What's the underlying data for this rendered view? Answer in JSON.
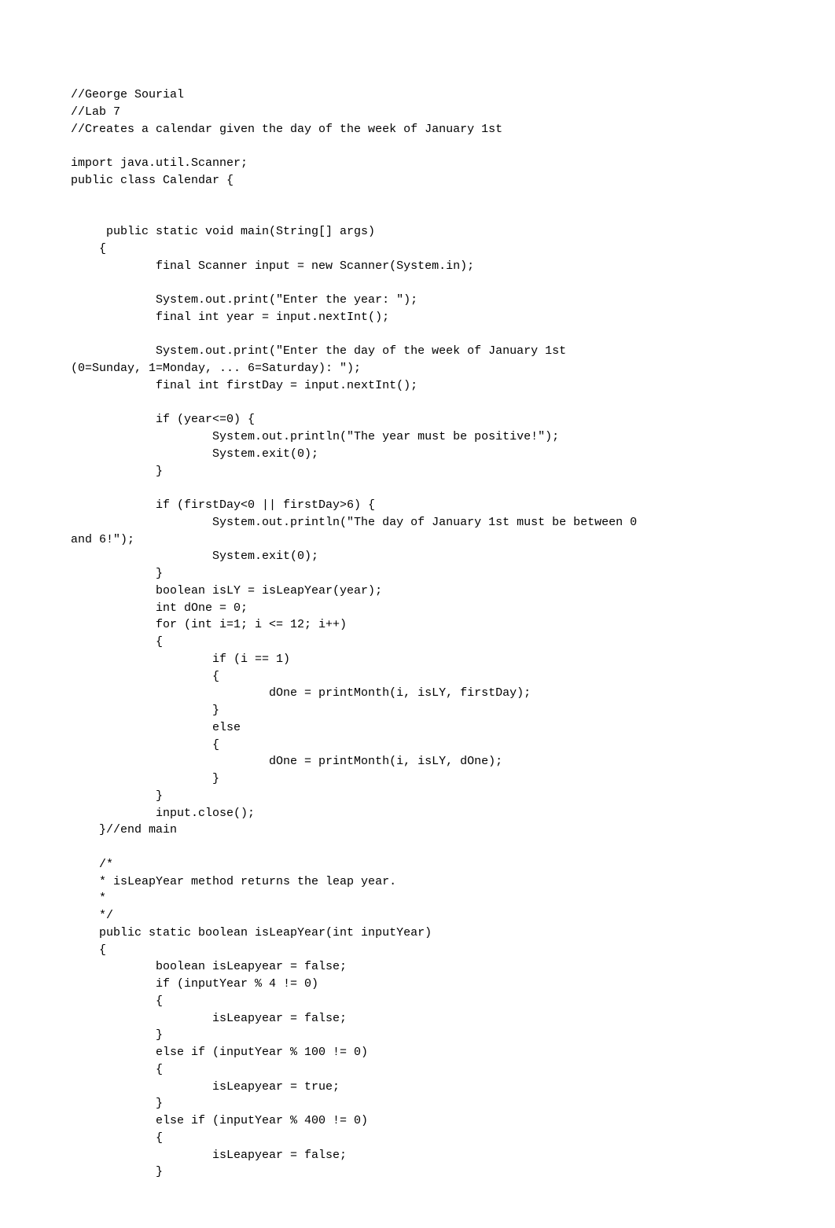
{
  "code": {
    "lines": [
      "//George Sourial",
      "//Lab 7",
      "//Creates a calendar given the day of the week of January 1st",
      "",
      "import java.util.Scanner;",
      "public class Calendar {",
      "",
      "",
      "     public static void main(String[] args)",
      "    {",
      "            final Scanner input = new Scanner(System.in);",
      "",
      "            System.out.print(\"Enter the year: \");",
      "            final int year = input.nextInt();",
      "",
      "            System.out.print(\"Enter the day of the week of January 1st ",
      "(0=Sunday, 1=Monday, ... 6=Saturday): \");",
      "            final int firstDay = input.nextInt();",
      "",
      "            if (year<=0) {",
      "                    System.out.println(\"The year must be positive!\");",
      "                    System.exit(0);",
      "            }",
      "",
      "            if (firstDay<0 || firstDay>6) {",
      "                    System.out.println(\"The day of January 1st must be between 0 ",
      "and 6!\");",
      "                    System.exit(0);",
      "            }",
      "            boolean isLY = isLeapYear(year);",
      "            int dOne = 0;",
      "            for (int i=1; i <= 12; i++)",
      "            {",
      "                    if (i == 1)",
      "                    {",
      "                            dOne = printMonth(i, isLY, firstDay);",
      "                    }",
      "                    else",
      "                    {",
      "                            dOne = printMonth(i, isLY, dOne);",
      "                    }",
      "            }",
      "            input.close();",
      "    }//end main",
      "",
      "    /*",
      "    * isLeapYear method returns the leap year.",
      "    *",
      "    */",
      "    public static boolean isLeapYear(int inputYear)",
      "    {",
      "            boolean isLeapyear = false;",
      "            if (inputYear % 4 != 0)",
      "            {",
      "                    isLeapyear = false;",
      "            }",
      "            else if (inputYear % 100 != 0)",
      "            {",
      "                    isLeapyear = true;",
      "            }",
      "            else if (inputYear % 400 != 0)",
      "            {",
      "                    isLeapyear = false;",
      "            }"
    ]
  }
}
